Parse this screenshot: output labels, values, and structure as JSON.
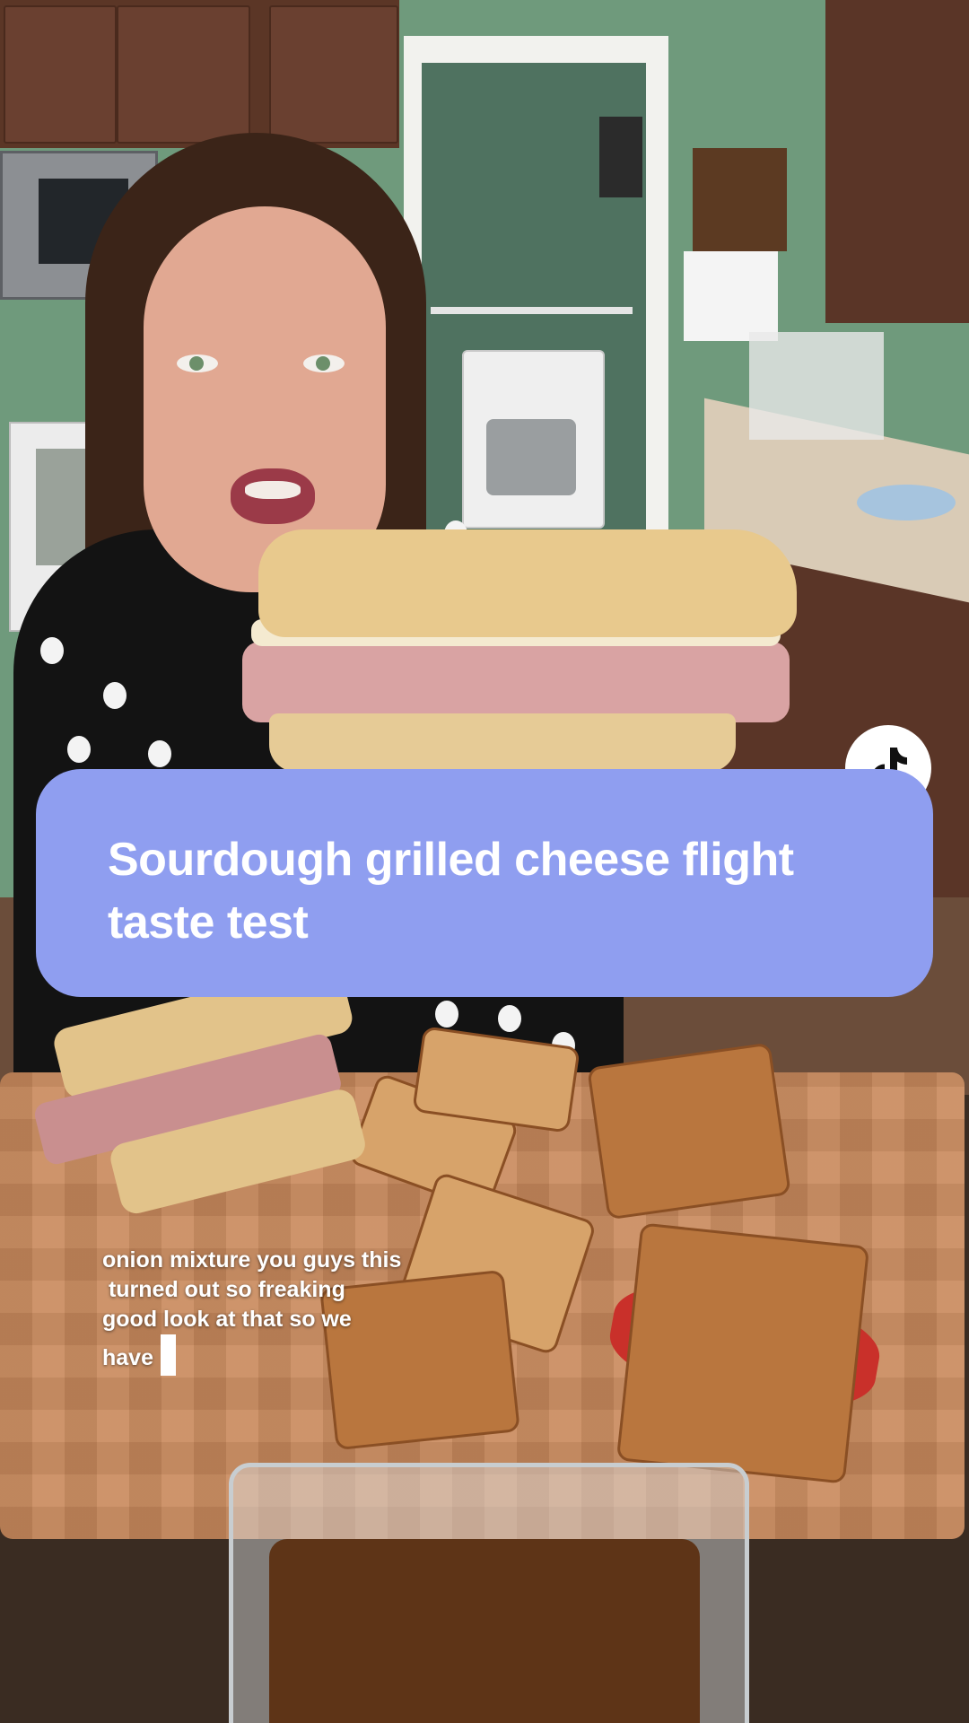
{
  "video_title": "Sourdough grilled cheese flight taste test",
  "caption_lines": [
    "onion mixture you guys this",
    " turned out so freaking",
    "good look at that so we",
    "have"
  ],
  "icons": {
    "platform_badge": "tiktok-logo-icon"
  },
  "colors": {
    "banner": "#8f9ef0",
    "banner_text": "#ffffff",
    "caption_text": "#ffffff"
  }
}
